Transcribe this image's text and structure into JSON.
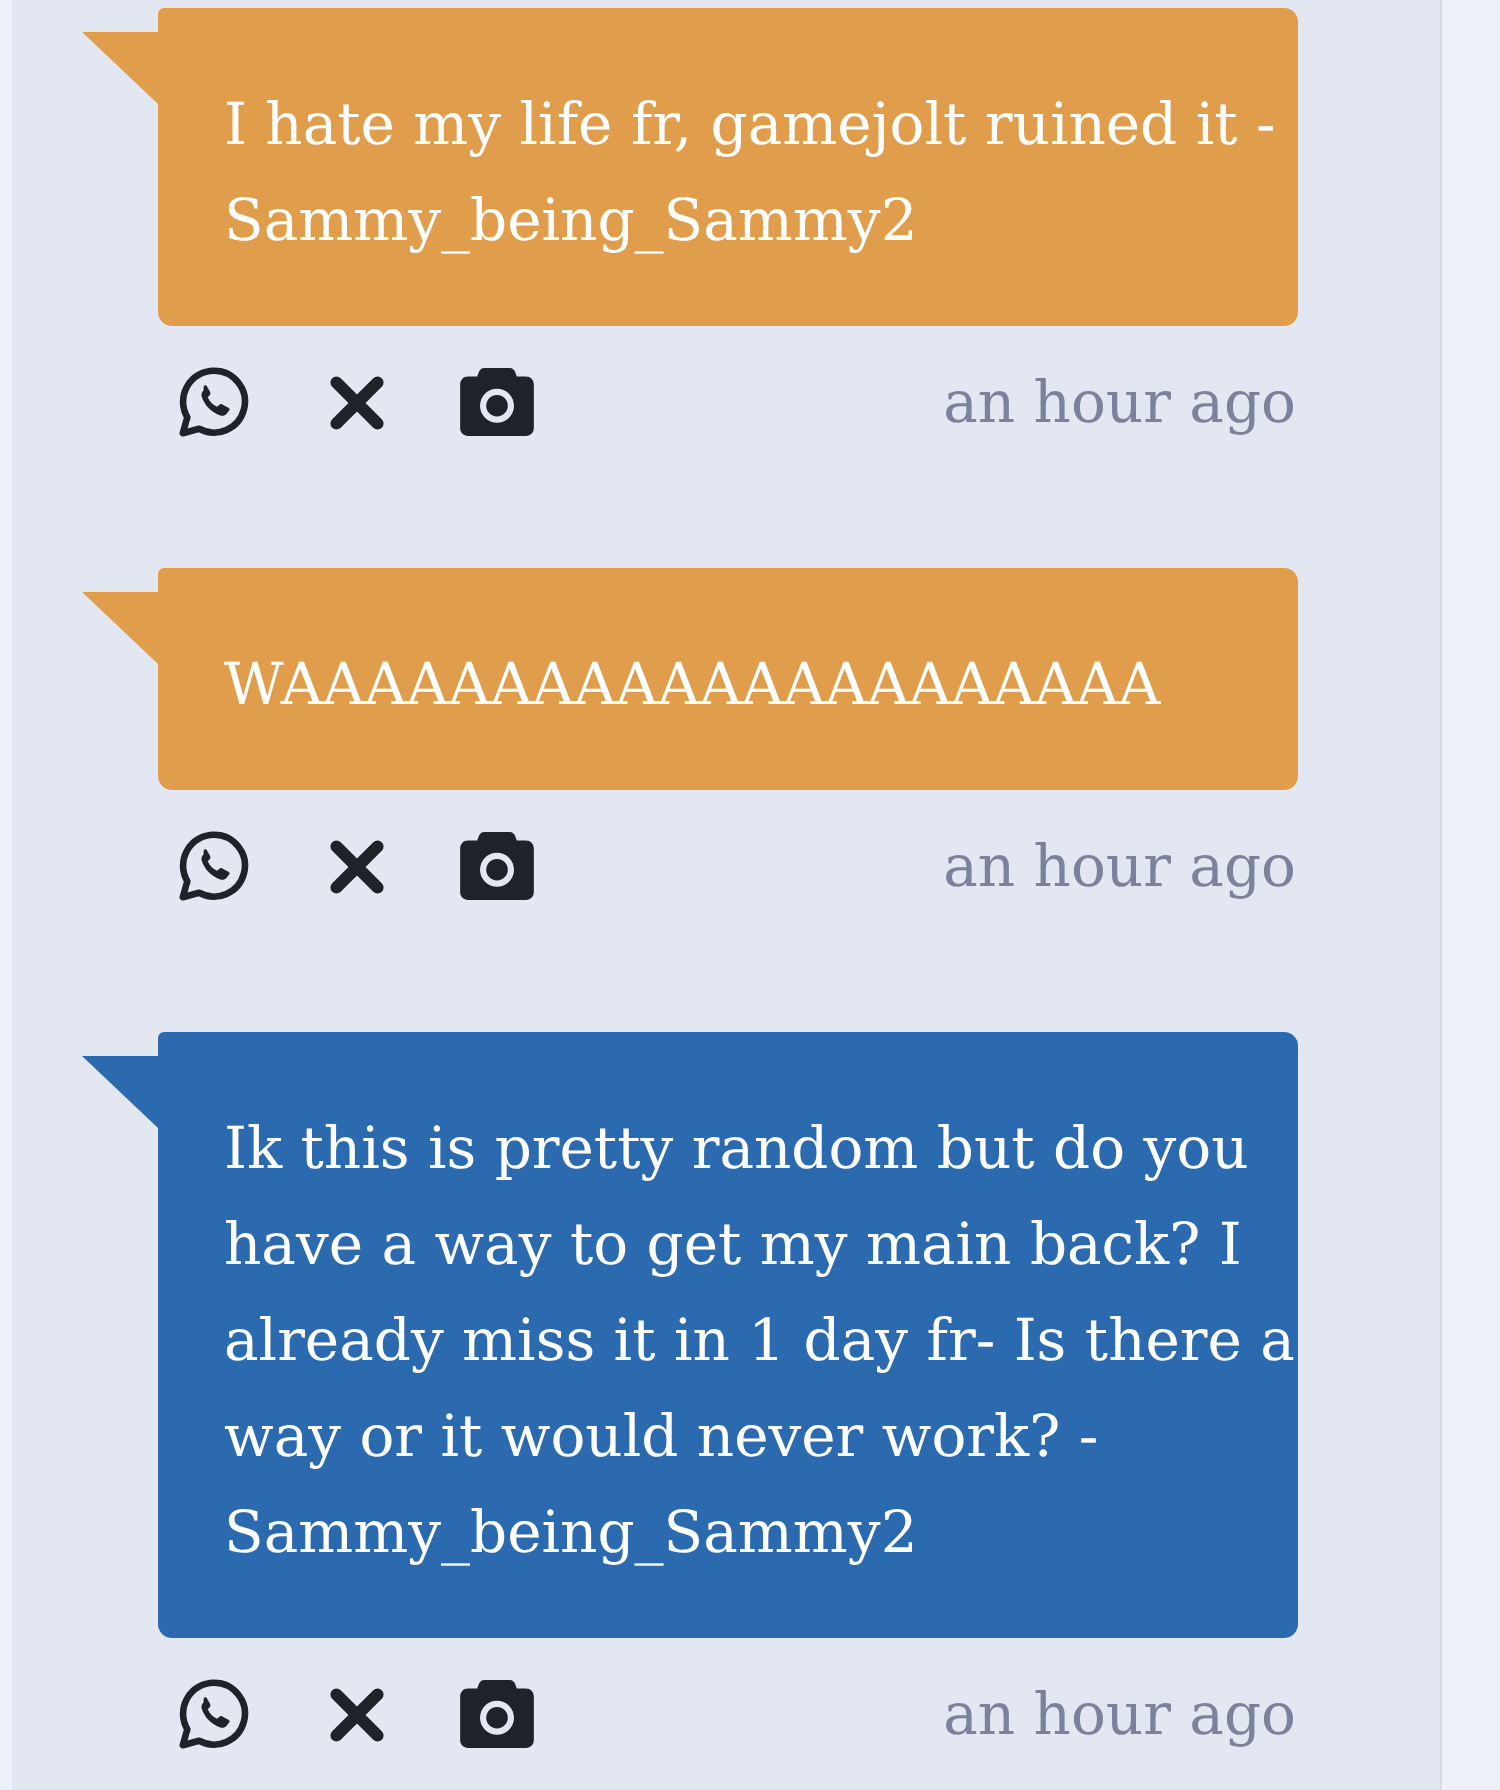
{
  "messages": [
    {
      "text": "I hate my life fr, gamejolt ruined it - Sammy_being_Sammy2",
      "color": "#e09e4c",
      "time": "an hour ago"
    },
    {
      "text": "WAAAAAAAAAAAAAAAAAAAAA",
      "color": "#e09e4c",
      "time": "an hour ago"
    },
    {
      "text": "Ik this is pretty random but do you have a way to get my main back? I already miss it in 1 day fr- Is there a way or it would never work? - Sammy_being_Sammy2",
      "color": "#2c6ab0",
      "time": "an hour ago"
    }
  ]
}
